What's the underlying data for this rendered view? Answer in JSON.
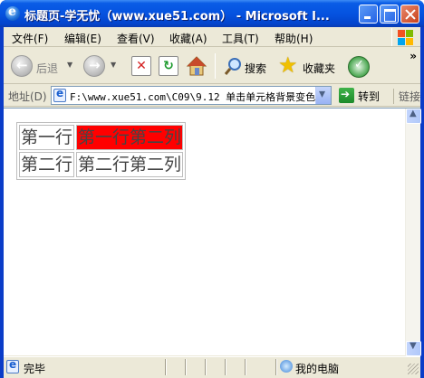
{
  "window": {
    "title": "标题页-学无忧（www.xue51.com） - Microsoft I..."
  },
  "menu": {
    "items": [
      "文件(F)",
      "编辑(E)",
      "查看(V)",
      "收藏(A)",
      "工具(T)",
      "帮助(H)"
    ]
  },
  "toolbar": {
    "back_label": "后退",
    "search_label": "搜索",
    "favorites_label": "收藏夹",
    "more": "»"
  },
  "address": {
    "label": "地址(D)",
    "url": "F:\\www.xue51.com\\C09\\9.12 单击单元格背景变色.",
    "go_label": "转到",
    "links_label": "链接"
  },
  "table": {
    "rows": [
      [
        "第一行",
        "第一行第二列"
      ],
      [
        "第二行",
        "第二行第二列"
      ]
    ],
    "highlight_color": "#ff0000"
  },
  "status": {
    "text": "完毕",
    "zone": "我的电脑"
  }
}
